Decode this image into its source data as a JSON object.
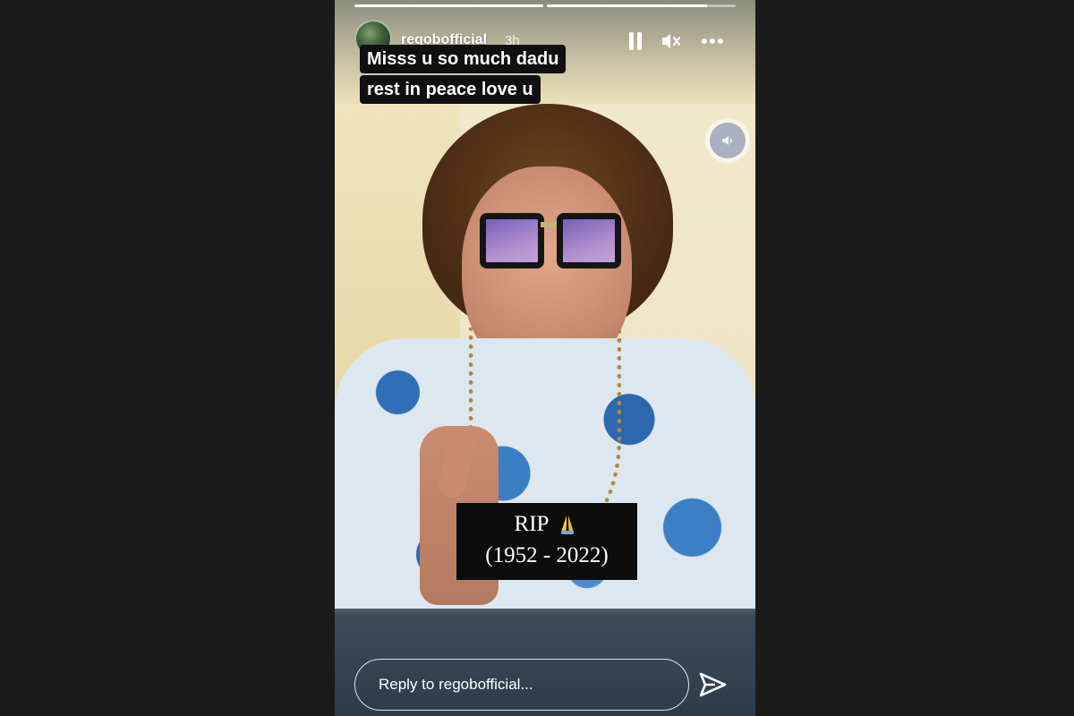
{
  "story": {
    "progress": [
      1.0,
      0.85
    ],
    "username": "regobofficial",
    "time": "3h",
    "caption_lines": [
      "Misss u so much dadu",
      "rest in peace love u"
    ],
    "overlay": {
      "line1": "RIP",
      "line2": "(1952 - 2022)"
    },
    "reply_placeholder": "Reply to regobofficial..."
  },
  "icons": {
    "pause": "pause-icon",
    "mute": "speaker-muted-icon",
    "more": "more-horizontal-icon",
    "volume": "speaker-icon",
    "pray": "folded-hands-emoji",
    "send": "paper-plane-icon"
  },
  "colors": {
    "background": "#1b1b1b",
    "overlay_bg": "#0d0d0d",
    "text": "#ffffff"
  }
}
